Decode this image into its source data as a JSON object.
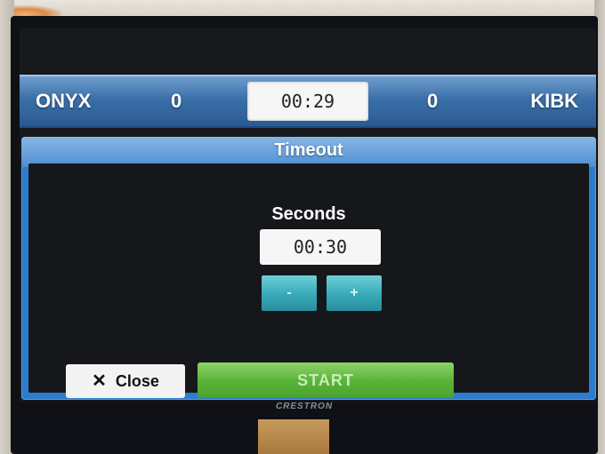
{
  "scoreboard": {
    "home_team": "ONYX",
    "home_score": "0",
    "clock": "00:29",
    "away_score": "0",
    "away_team": "KIBK"
  },
  "timeout_dialog": {
    "title": "Timeout",
    "seconds_label": "Seconds",
    "seconds_value": "00:30",
    "decrement_label": "-",
    "increment_label": "+",
    "close_icon": "✕",
    "close_label": "Close",
    "start_label": "START"
  },
  "device": {
    "brand": "CRESTRON"
  },
  "colors": {
    "header_blue": "#3b6fa8",
    "dialog_blue": "#2f7bcc",
    "stepper_teal": "#36a9b8",
    "start_green": "#5bb53a"
  }
}
